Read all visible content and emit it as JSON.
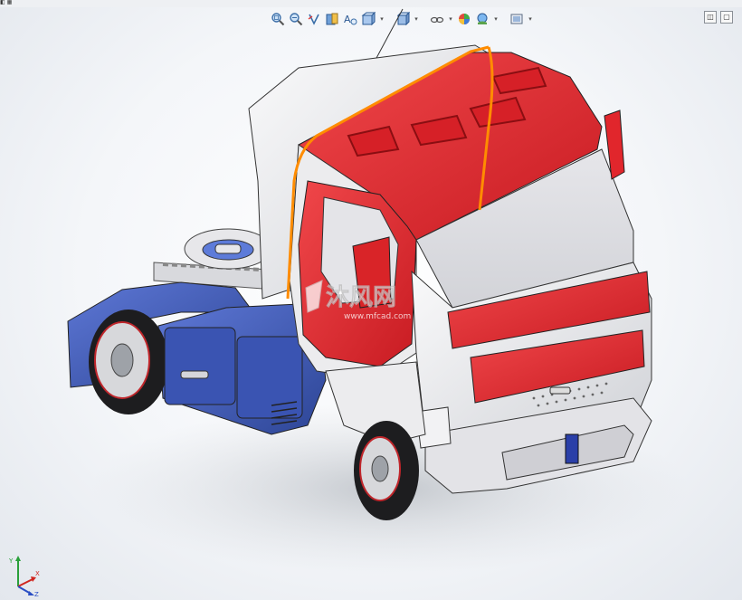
{
  "app": {
    "corner_tab_label": "◧ ▦"
  },
  "toolbar": {
    "items": [
      {
        "icon": "zoom-to-fit-icon"
      },
      {
        "icon": "zoom-to-area-icon"
      },
      {
        "icon": "previous-view-icon"
      },
      {
        "icon": "section-view-icon"
      },
      {
        "icon": "dynamic-annotation-icon"
      },
      {
        "icon": "view-orientation-icon",
        "dropdown": true
      },
      {
        "icon": "display-style-icon",
        "dropdown": true
      },
      {
        "icon": "hide-show-items-icon",
        "dropdown": true
      },
      {
        "icon": "edit-appearance-icon",
        "dropdown": false
      },
      {
        "icon": "apply-scene-icon",
        "dropdown": true
      },
      {
        "icon": "view-settings-icon",
        "dropdown": true
      }
    ],
    "dropdown_glyph": "▾"
  },
  "window_controls": {
    "restore_label": "◫",
    "close_label": "▢"
  },
  "watermark": {
    "brand_text": "沐风网",
    "url_text": "www.mfcad.com"
  },
  "triad": {
    "x_label": "X",
    "y_label": "Y",
    "z_label": "Z"
  },
  "colors": {
    "cab_red": "#e2272c",
    "cab_white": "#ececee",
    "chassis_blue": "#3c57b6",
    "selection_orange": "#ff8c00",
    "tire_dark": "#1d1d1f"
  }
}
